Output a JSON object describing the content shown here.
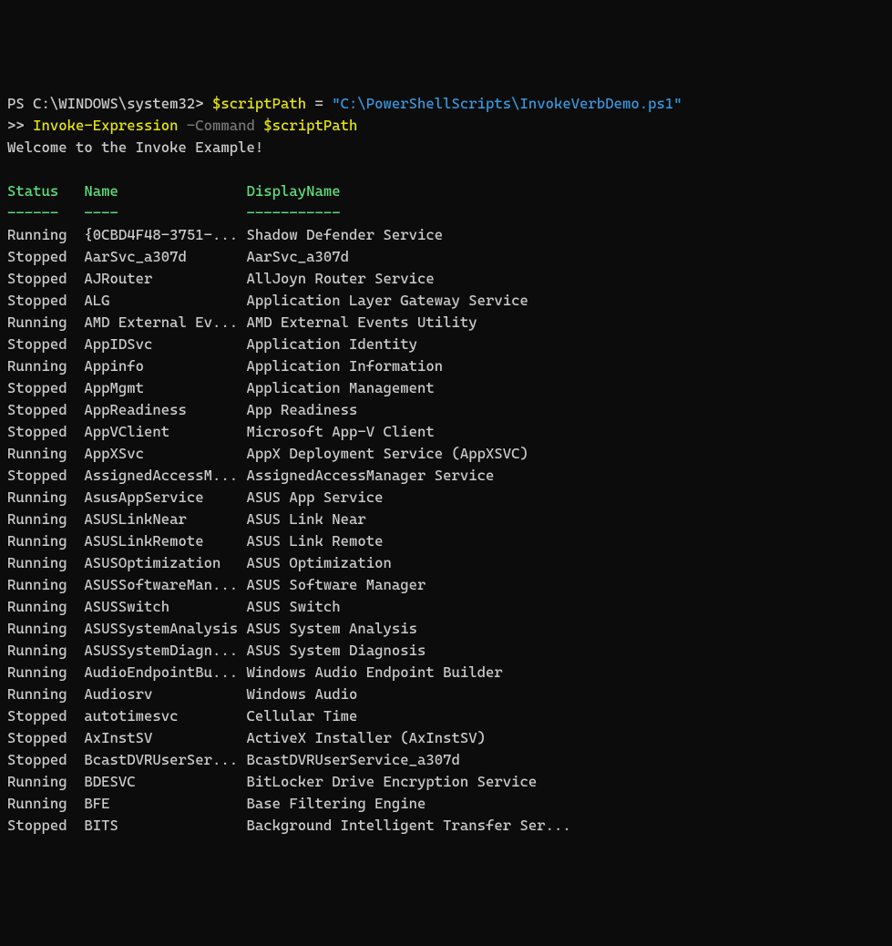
{
  "prompt": {
    "ps_prefix": "PS ",
    "path": "C:\\WINDOWS\\system32",
    "gt": "> ",
    "var_name": "$scriptPath",
    "equals": " = ",
    "string_val": "\"C:\\PowerShellScripts\\InvokeVerbDemo.ps1\""
  },
  "line2": {
    "continuation": ">> ",
    "cmd": "Invoke-Expression",
    "space": " ",
    "param": "-Command",
    "space2": " ",
    "var": "$scriptPath"
  },
  "welcome": "Welcome to the Invoke Example!",
  "headers": {
    "status": "Status",
    "name": "Name",
    "displayname": "DisplayName"
  },
  "dashes": {
    "status": "------",
    "name": "----",
    "displayname": "-----------"
  },
  "col_widths": {
    "status": 9,
    "name": 19
  },
  "services": [
    {
      "status": "Running",
      "name": "{0CBD4F48-3751-...",
      "display": "Shadow Defender Service"
    },
    {
      "status": "Stopped",
      "name": "AarSvc_a307d",
      "display": "AarSvc_a307d"
    },
    {
      "status": "Stopped",
      "name": "AJRouter",
      "display": "AllJoyn Router Service"
    },
    {
      "status": "Stopped",
      "name": "ALG",
      "display": "Application Layer Gateway Service"
    },
    {
      "status": "Running",
      "name": "AMD External Ev...",
      "display": "AMD External Events Utility"
    },
    {
      "status": "Stopped",
      "name": "AppIDSvc",
      "display": "Application Identity"
    },
    {
      "status": "Running",
      "name": "Appinfo",
      "display": "Application Information"
    },
    {
      "status": "Stopped",
      "name": "AppMgmt",
      "display": "Application Management"
    },
    {
      "status": "Stopped",
      "name": "AppReadiness",
      "display": "App Readiness"
    },
    {
      "status": "Stopped",
      "name": "AppVClient",
      "display": "Microsoft App-V Client"
    },
    {
      "status": "Running",
      "name": "AppXSvc",
      "display": "AppX Deployment Service (AppXSVC)"
    },
    {
      "status": "Stopped",
      "name": "AssignedAccessM...",
      "display": "AssignedAccessManager Service"
    },
    {
      "status": "Running",
      "name": "AsusAppService",
      "display": "ASUS App Service"
    },
    {
      "status": "Running",
      "name": "ASUSLinkNear",
      "display": "ASUS Link Near"
    },
    {
      "status": "Running",
      "name": "ASUSLinkRemote",
      "display": "ASUS Link Remote"
    },
    {
      "status": "Running",
      "name": "ASUSOptimization",
      "display": "ASUS Optimization"
    },
    {
      "status": "Running",
      "name": "ASUSSoftwareMan...",
      "display": "ASUS Software Manager"
    },
    {
      "status": "Running",
      "name": "ASUSSwitch",
      "display": "ASUS Switch"
    },
    {
      "status": "Running",
      "name": "ASUSSystemAnalysis",
      "display": "ASUS System Analysis"
    },
    {
      "status": "Running",
      "name": "ASUSSystemDiagn...",
      "display": "ASUS System Diagnosis"
    },
    {
      "status": "Running",
      "name": "AudioEndpointBu...",
      "display": "Windows Audio Endpoint Builder"
    },
    {
      "status": "Running",
      "name": "Audiosrv",
      "display": "Windows Audio"
    },
    {
      "status": "Stopped",
      "name": "autotimesvc",
      "display": "Cellular Time"
    },
    {
      "status": "Stopped",
      "name": "AxInstSV",
      "display": "ActiveX Installer (AxInstSV)"
    },
    {
      "status": "Stopped",
      "name": "BcastDVRUserSer...",
      "display": "BcastDVRUserService_a307d"
    },
    {
      "status": "Running",
      "name": "BDESVC",
      "display": "BitLocker Drive Encryption Service"
    },
    {
      "status": "Running",
      "name": "BFE",
      "display": "Base Filtering Engine"
    },
    {
      "status": "Stopped",
      "name": "BITS",
      "display": "Background Intelligent Transfer Ser..."
    }
  ]
}
